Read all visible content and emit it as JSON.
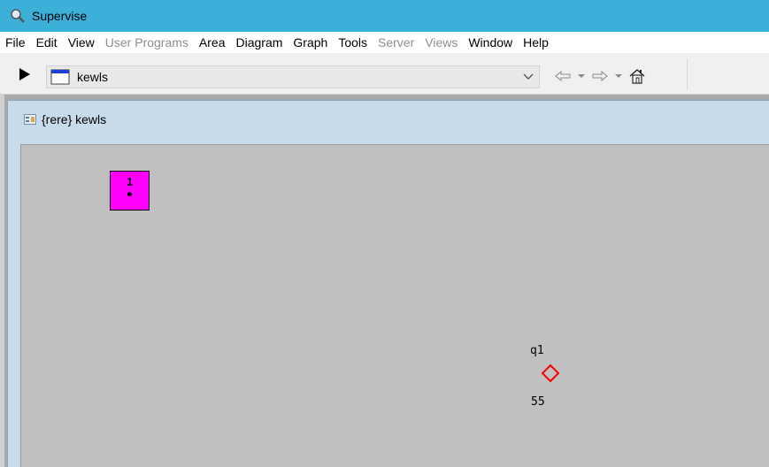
{
  "window": {
    "title": "Supervise"
  },
  "menubar": {
    "items": [
      {
        "label": "File",
        "enabled": true
      },
      {
        "label": "Edit",
        "enabled": true
      },
      {
        "label": "View",
        "enabled": true
      },
      {
        "label": "User Programs",
        "enabled": false
      },
      {
        "label": "Area",
        "enabled": true
      },
      {
        "label": "Diagram",
        "enabled": true
      },
      {
        "label": "Graph",
        "enabled": true
      },
      {
        "label": "Tools",
        "enabled": true
      },
      {
        "label": "Server",
        "enabled": false
      },
      {
        "label": "Views",
        "enabled": false
      },
      {
        "label": "Window",
        "enabled": true
      },
      {
        "label": "Help",
        "enabled": true
      }
    ]
  },
  "toolbar": {
    "run_icon": "play-icon",
    "combo_value": "kewls",
    "combo_icon": "window-icon",
    "nav_icons": [
      "back-arrow-icon",
      "back-dropdown-icon",
      "forward-arrow-icon",
      "forward-dropdown-icon",
      "home-icon"
    ]
  },
  "child_window": {
    "title": "{rere} kewls",
    "icon": "diagram-window-icon"
  },
  "canvas": {
    "block": {
      "number": "1",
      "color": "#ff00ff"
    },
    "node": {
      "name": "q1",
      "value": "55",
      "color": "#ff0000",
      "shape": "diamond"
    }
  },
  "colors": {
    "titlebar": "#3cb0d8",
    "canvas": "#c0c0c0",
    "child_frame": "#c8dbeb"
  }
}
